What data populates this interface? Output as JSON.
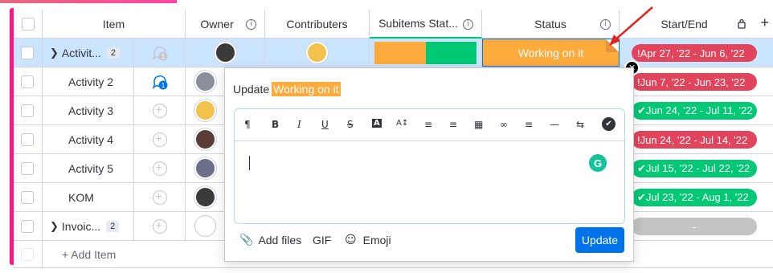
{
  "columns": {
    "item": "Item",
    "owner": "Owner",
    "contributers": "Contributers",
    "subitems_status": "Subitems Stat...",
    "status": "Status",
    "start_end": "Start/End"
  },
  "rows": [
    {
      "name": "Activit...",
      "count": "2",
      "updates": "1",
      "dates": "!Apr 27, '22 - Jun 6, '22",
      "date_color": "#e2445c"
    },
    {
      "name": "Activity 2",
      "updates": "1",
      "dates": "!Jun 7, '22 - Jun 23, '22",
      "date_color": "#e2445c"
    },
    {
      "name": "Activity 3",
      "dates": "✔Jun 24, '22 - Jul 11, '22",
      "date_color": "#00c875"
    },
    {
      "name": "Activity 4",
      "dates": "!Jun 24, '22 - Jul 14, '22",
      "date_color": "#e2445c"
    },
    {
      "name": "Activity 5",
      "dates": "✔Jul 15, '22 - Jul 22, '22",
      "date_color": "#00c875"
    },
    {
      "name": "KOM",
      "dates": "✔Jul 23, '22 - Aug 1, '22",
      "date_color": "#00c875"
    },
    {
      "name": "Invoic...",
      "count": "2",
      "dates": "-",
      "date_color": "#c4c4c4"
    }
  ],
  "add_item": "+ Add Item",
  "status_label": "Working on it",
  "colors": {
    "working": "#fdab3d",
    "done": "#00c875",
    "stuck": "#e2445c",
    "accent": "#0073ea"
  },
  "popup": {
    "update_prefix": "Update",
    "status_chip": "Working on it",
    "add_files": "Add files",
    "gif": "GIF",
    "emoji": "Emoji",
    "update_button": "Update"
  },
  "toolbar_icons": [
    "paragraph-icon",
    "bold-icon",
    "italic-icon",
    "underline-icon",
    "strikethrough-icon",
    "text-color-icon",
    "font-size-icon",
    "numbered-list-icon",
    "bullet-list-icon",
    "table-icon",
    "link-icon",
    "align-icon",
    "divider-icon",
    "direction-icon",
    "checkmark-icon"
  ]
}
